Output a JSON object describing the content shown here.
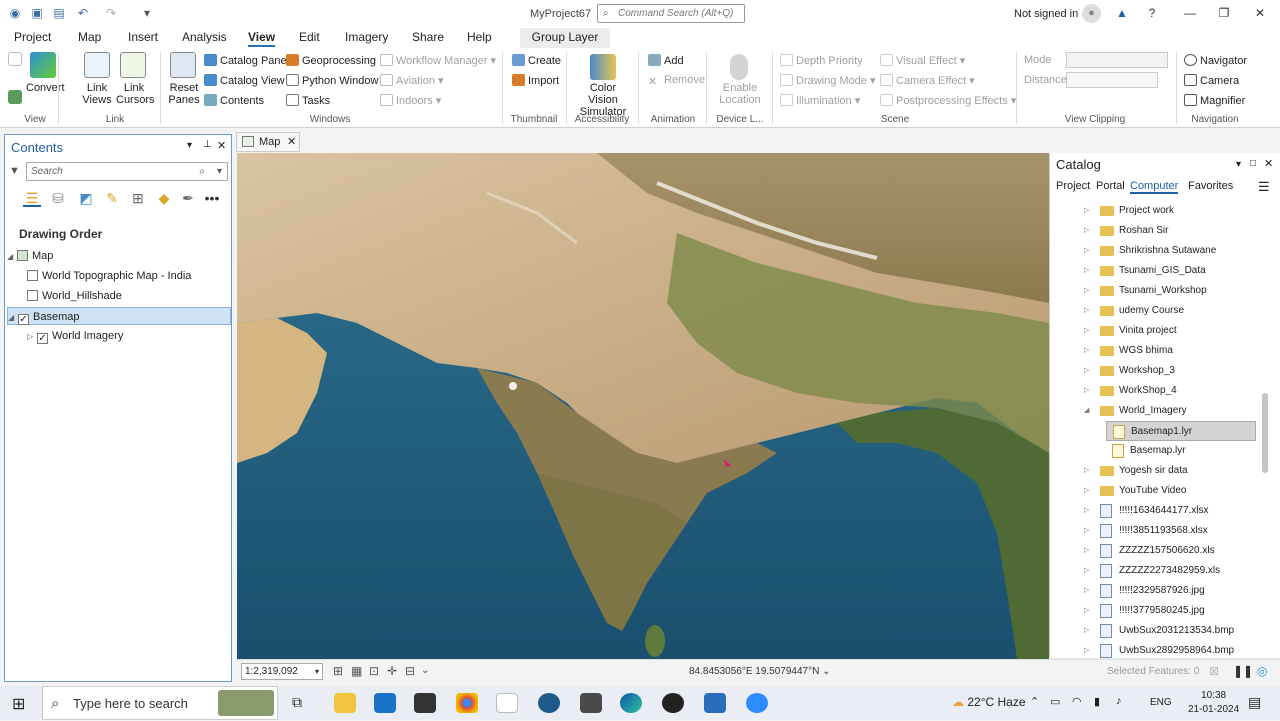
{
  "title_bar": {
    "project": "MyProject67",
    "search_placeholder": "Command Search (Alt+Q)",
    "signin": "Not signed in"
  },
  "ribbon_tabs": [
    "Project",
    "Map",
    "Insert",
    "Analysis",
    "View",
    "Edit",
    "Imagery",
    "Share",
    "Help"
  ],
  "active_tab": "View",
  "context_tab": "Group Layer",
  "ribbon": {
    "convert": "Convert",
    "link_views": "Link Views",
    "link_cursors": "Link Cursors",
    "reset_panes": "Reset Panes",
    "catalog_pane": "Catalog Pane",
    "catalog_view": "Catalog View",
    "contents": "Contents",
    "geoprocessing": "Geoprocessing",
    "python_window": "Python Window",
    "tasks": "Tasks",
    "workflow_manager": "Workflow Manager",
    "aviation": "Aviation",
    "indoors": "Indoors",
    "create": "Create",
    "import": "Import",
    "color_vision": "Color Vision Simulator",
    "add": "Add",
    "remove": "Remove",
    "enable_location": "Enable Location",
    "depth_priority": "Depth Priority",
    "drawing_mode": "Drawing Mode",
    "illumination": "Illumination",
    "visual_effect": "Visual Effect",
    "camera_effect": "Camera Effect",
    "postprocessing": "Postprocessing Effects",
    "mode": "Mode",
    "distance": "Distance",
    "navigator": "Navigator",
    "camera": "Camera",
    "magnifier": "Magnifier",
    "groups": {
      "view": "View",
      "link": "Link",
      "windows": "Windows",
      "thumbnail": "Thumbnail",
      "accessibility": "Accessibility",
      "animation": "Animation",
      "device": "Device L...",
      "scene": "Scene",
      "clipping": "View Clipping",
      "navigation": "Navigation"
    }
  },
  "contents": {
    "title": "Contents",
    "search_placeholder": "Search",
    "drawing_order": "Drawing Order",
    "layers": [
      {
        "name": "Map",
        "checked": null
      },
      {
        "name": "World Topographic Map - India",
        "checked": false
      },
      {
        "name": "World_Hillshade",
        "checked": false
      },
      {
        "name": "Basemap",
        "checked": true,
        "selected": true
      },
      {
        "name": "World Imagery",
        "checked": true
      }
    ]
  },
  "map": {
    "tab": "Map",
    "scale": "1:2,319,092",
    "coordinates": "84.8453056°E 19.5079447°N",
    "selected_features": "Selected Features: 0"
  },
  "catalog": {
    "title": "Catalog",
    "tabs": [
      "Project",
      "Portal",
      "Computer",
      "Favorites"
    ],
    "active_tab": "Computer",
    "items": [
      {
        "name": "Project work",
        "type": "folder"
      },
      {
        "name": "Roshan Sir",
        "type": "folder"
      },
      {
        "name": "Shrikrishna Sutawane",
        "type": "folder"
      },
      {
        "name": "Tsunami_GIS_Data",
        "type": "folder"
      },
      {
        "name": "Tsunami_Workshop",
        "type": "folder"
      },
      {
        "name": "udemy Course",
        "type": "folder"
      },
      {
        "name": "Vinita project",
        "type": "folder"
      },
      {
        "name": "WGS bhima",
        "type": "folder"
      },
      {
        "name": "Workshop_3",
        "type": "folder"
      },
      {
        "name": "WorkShop_4",
        "type": "folder"
      },
      {
        "name": "World_Imagery",
        "type": "folder",
        "expanded": true
      },
      {
        "name": "Basemap1.lyr",
        "type": "layerfile",
        "child": true,
        "selected": true
      },
      {
        "name": "Basemap.lyr",
        "type": "layerfile",
        "child": true
      },
      {
        "name": "Yogesh sir data",
        "type": "folder"
      },
      {
        "name": "YouTube Video",
        "type": "folder"
      },
      {
        "name": "!!!!!1634644177.xlsx",
        "type": "file"
      },
      {
        "name": "!!!!!3851193568.xlsx",
        "type": "file"
      },
      {
        "name": "ZZZZZ157506620.xls",
        "type": "file"
      },
      {
        "name": "ZZZZZ2273482959.xls",
        "type": "file"
      },
      {
        "name": "!!!!!2329587926.jpg",
        "type": "file"
      },
      {
        "name": "!!!!!3779580245.jpg",
        "type": "file"
      },
      {
        "name": "UwbSux2031213534.bmp",
        "type": "file"
      },
      {
        "name": "UwbSux2892958964.bmp",
        "type": "file"
      }
    ]
  },
  "taskbar": {
    "search": "Type here to search",
    "temperature": "22°C",
    "weather": "Haze",
    "lang": "ENG",
    "time": "10:38",
    "date": "21-01-2024"
  }
}
